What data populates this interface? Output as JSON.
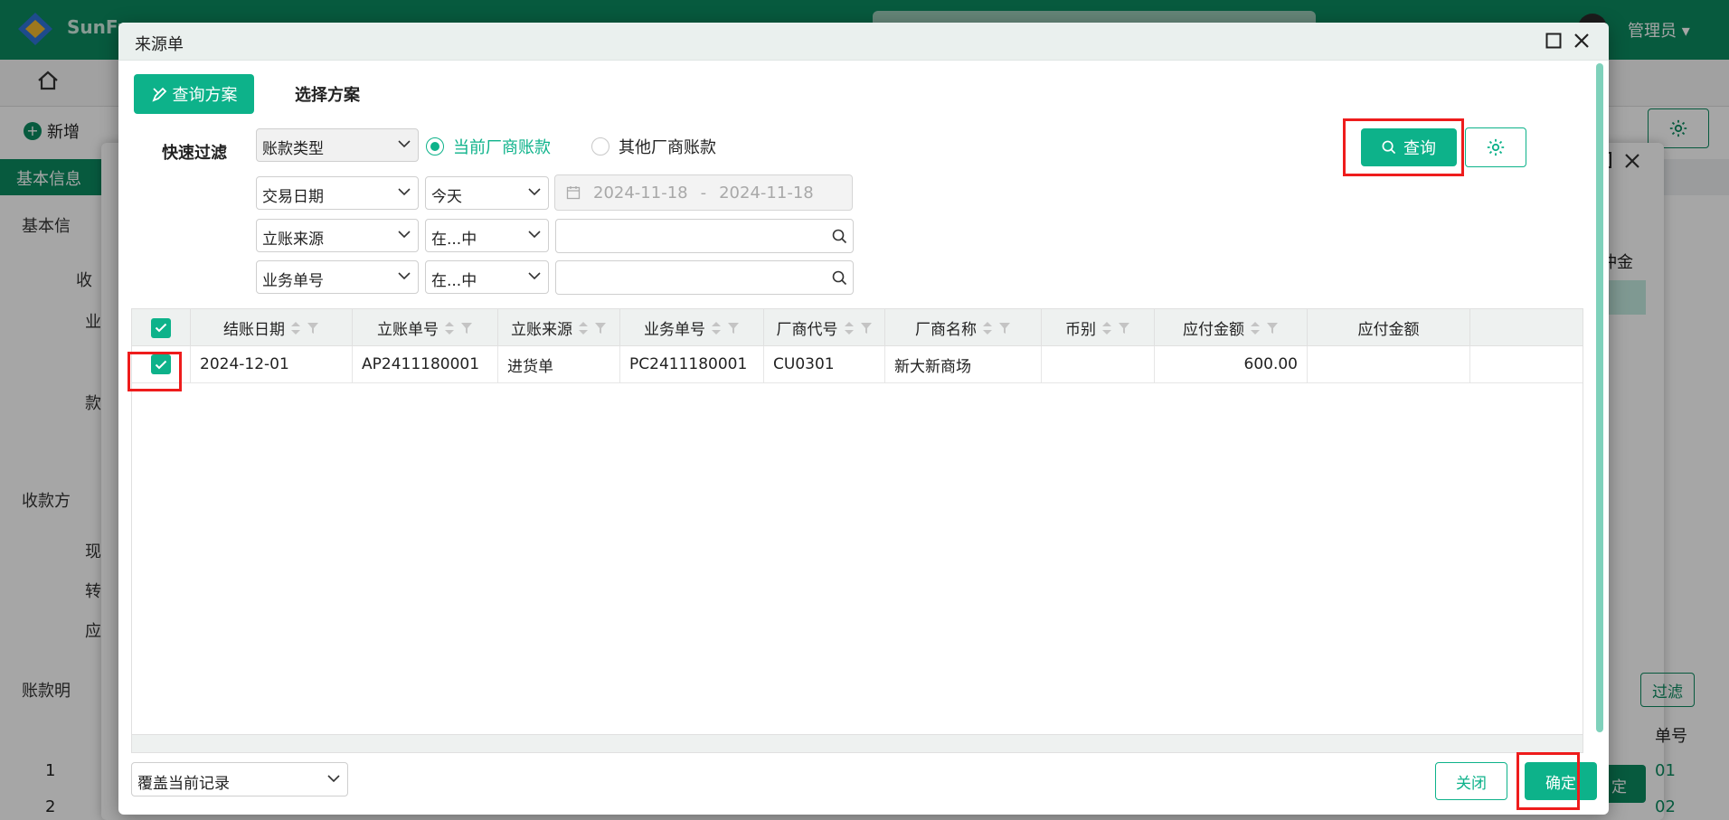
{
  "background": {
    "brand": "SunFu",
    "user": "管理员 ▾",
    "new_label": "新增",
    "tab_label": "基本信息",
    "sections": [
      "基本信",
      "收款方",
      "账款明"
    ],
    "side_labels": [
      "收",
      "业",
      "款",
      "现",
      "转",
      "应"
    ],
    "dialog2_col": "冲金",
    "dialog2_filter": "过滤",
    "dialog2_ok": "定",
    "dialog2_col2": "单号",
    "row_nums": [
      "1",
      "2"
    ],
    "row_tails": [
      "01",
      "02"
    ]
  },
  "dialog": {
    "title": "来源单",
    "scheme_button": "查询方案",
    "choose_scheme": "选择方案",
    "quick_filter": "快速过滤",
    "filter_rows": [
      {
        "field": "账款类型"
      },
      {
        "field": "交易日期",
        "op": "今天"
      },
      {
        "field": "立账来源",
        "op": "在...中"
      },
      {
        "field": "业务单号",
        "op": "在...中"
      }
    ],
    "radio_current": "当前厂商账款",
    "radio_other": "其他厂商账款",
    "date_from": "2024-11-18",
    "date_sep": "-",
    "date_to": "2024-11-18",
    "query_button": "查询",
    "columns": [
      "结账日期",
      "立账单号",
      "立账来源",
      "业务单号",
      "厂商代号",
      "厂商名称",
      "币别",
      "应付金额",
      "应付金额"
    ],
    "rows": [
      [
        "2024-12-01",
        "AP2411180001",
        "进货单",
        "PC2411180001",
        "CU0301",
        "新大新商场",
        "",
        "600.00",
        ""
      ]
    ],
    "footer_select": "覆盖当前记录",
    "close_button": "关闭",
    "ok_button": "确定"
  },
  "colors": {
    "accent": "#0db28a",
    "topbar": "#0b8a60",
    "highlight": "#ee1c1c"
  }
}
